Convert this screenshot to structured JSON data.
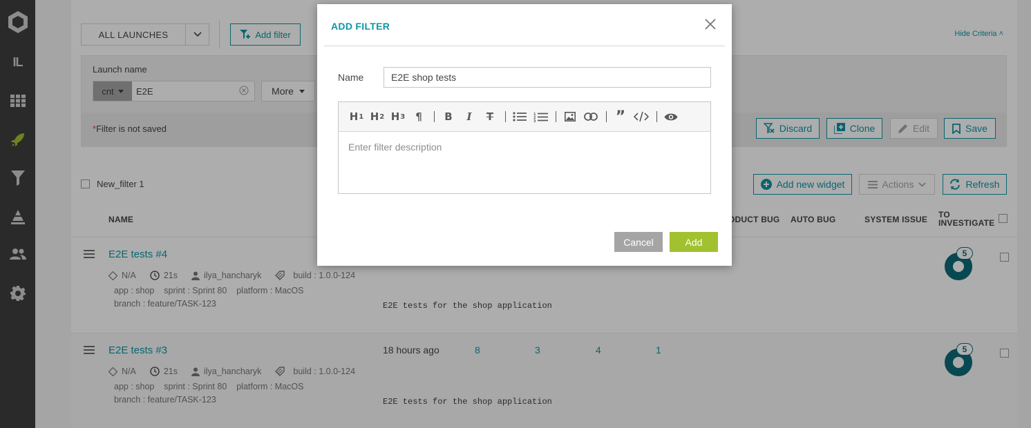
{
  "sidebar": {
    "user_initials": "IL",
    "items": [
      "dashboard-icon",
      "launches-icon",
      "filters-icon",
      "debug-icon",
      "members-icon",
      "settings-icon"
    ]
  },
  "toolbar": {
    "launches_select": "ALL LAUNCHES",
    "add_filter": "Add filter",
    "hide_criteria": "Hide Criteria"
  },
  "criteria": {
    "label": "Launch name",
    "condition": "cnt",
    "value": "E2E",
    "more": "More",
    "not_saved_star": "*",
    "not_saved": "Filter is not saved",
    "buttons": {
      "discard": "Discard",
      "clone": "Clone",
      "edit": "Edit",
      "save": "Save"
    }
  },
  "widget_bar": {
    "filter_name": "New_filter 1",
    "add_widget": "Add new widget",
    "actions": "Actions",
    "refresh": "Refresh"
  },
  "table": {
    "headers": {
      "name": "NAME",
      "product_bug": "ODUCT BUG",
      "auto_bug": "AUTO BUG",
      "system_issue": "SYSTEM ISSUE",
      "to_investigate_1": "TO",
      "to_investigate_2": "INVESTIGATE"
    },
    "rows": [
      {
        "title": "E2E tests #4",
        "status": "N/A",
        "duration": "21s",
        "owner": "ilya_hancharyk",
        "build": "build : 1.0.0-124",
        "app": "app : shop",
        "sprint": "sprint : Sprint 80",
        "platform": "platform : MacOS",
        "branch": "branch : feature/TASK-123",
        "description": "E2E tests for the shop application",
        "time": "",
        "to_investigate": "5"
      },
      {
        "title": "E2E tests #3",
        "status": "N/A",
        "duration": "21s",
        "owner": "ilya_hancharyk",
        "build": "build : 1.0.0-124",
        "app": "app : shop",
        "sprint": "sprint : Sprint 80",
        "platform": "platform : MacOS",
        "branch": "branch : feature/TASK-123",
        "description": "E2E tests for the shop application",
        "time": "18 hours ago",
        "counts": [
          "8",
          "3",
          "4",
          "1"
        ],
        "to_investigate": "5"
      }
    ]
  },
  "modal": {
    "title": "ADD FILTER",
    "name_label": "Name",
    "name_value": "E2E shop tests",
    "description_placeholder": "Enter filter description",
    "cancel": "Cancel",
    "add": "Add"
  },
  "colors": {
    "accent": "#0d96a6",
    "green": "#a2c12f",
    "sidebar": "#3e3e3e"
  }
}
